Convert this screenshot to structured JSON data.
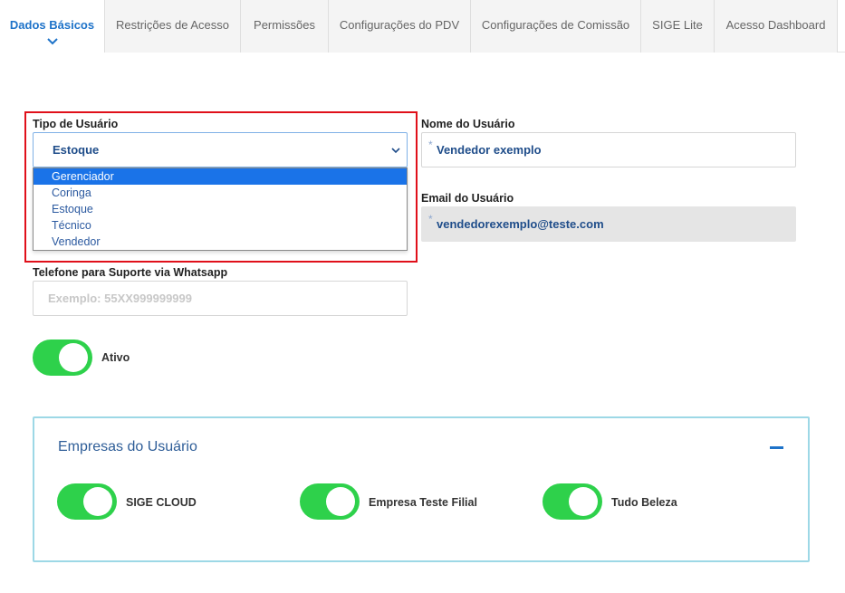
{
  "tabs": [
    {
      "label": "Dados Básicos",
      "active": true
    },
    {
      "label": "Restrições de Acesso"
    },
    {
      "label": "Permissões"
    },
    {
      "label": "Configurações do PDV"
    },
    {
      "label": "Configurações de Comissão"
    },
    {
      "label": "SIGE Lite"
    },
    {
      "label": "Acesso Dashboard"
    }
  ],
  "user_type": {
    "label": "Tipo de Usuário",
    "selected": "Estoque",
    "options": [
      "Gerenciador",
      "Coringa",
      "Estoque",
      "Técnico",
      "Vendedor"
    ],
    "highlighted": "Gerenciador"
  },
  "user_name": {
    "label": "Nome do Usuário",
    "value": "Vendedor exemplo",
    "required_mark": "*"
  },
  "user_email": {
    "label": "Email do Usuário",
    "value": "vendedorexemplo@teste.com",
    "required_mark": "*"
  },
  "whatsapp": {
    "label": "Telefone para Suporte via Whatsapp",
    "placeholder": "Exemplo: 55XX999999999"
  },
  "active_toggle": {
    "label": "Ativo",
    "on": true
  },
  "companies_panel": {
    "title": "Empresas do Usuário",
    "companies": [
      {
        "name": "SIGE CLOUD",
        "on": true
      },
      {
        "name": "Empresa Teste Filial",
        "on": true
      },
      {
        "name": "Tudo Beleza",
        "on": true
      }
    ]
  },
  "colors": {
    "accent": "#1e73c9",
    "toggle_on": "#2ed14b",
    "highlight": "#e0101a"
  }
}
